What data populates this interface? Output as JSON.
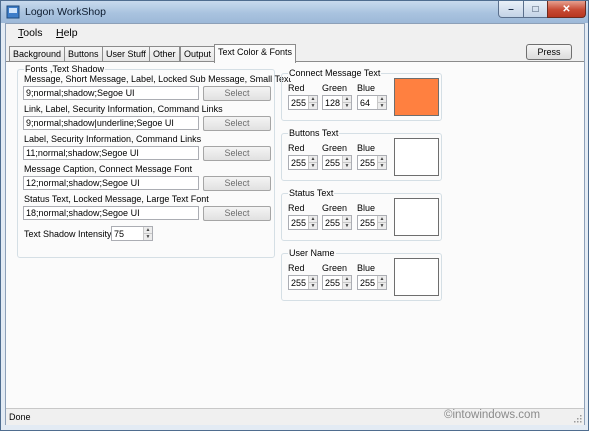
{
  "window": {
    "title": "Logon WorkShop"
  },
  "menu": [
    {
      "label": "Tools",
      "mnemonic": "T",
      "rest": "ools"
    },
    {
      "label": "Help",
      "mnemonic": "H",
      "rest": "elp"
    }
  ],
  "tabs": [
    "Background",
    "Buttons",
    "User Stuff",
    "Other",
    "Output",
    "Text Color & Fonts"
  ],
  "active_tab": "Text Color & Fonts",
  "press_button": "Press",
  "fonts_group": {
    "title": "Fonts ,Text Shadow",
    "rows": [
      {
        "label": "Message, Short Message, Label, Locked Sub Message, Small Text",
        "value": "9;normal;shadow;Segoe UI",
        "button": "Select"
      },
      {
        "label": "Link, Label, Security Information, Command Links",
        "value": "9;normal;shadow|underline;Segoe UI",
        "button": "Select"
      },
      {
        "label": "Label, Security Information, Command Links",
        "value": "11;normal;shadow;Segoe UI",
        "button": "Select"
      },
      {
        "label": "Message Caption, Connect Message Font",
        "value": "12;normal;shadow;Segoe UI",
        "button": "Select"
      },
      {
        "label": "Status Text, Locked Message, Large Text Font",
        "value": "18;normal;shadow;Segoe UI",
        "button": "Select"
      }
    ],
    "shadow_intensity_label": "Text Shadow Intensity:",
    "shadow_intensity_value": "75"
  },
  "color_groups": [
    {
      "title": "Connect Message Text",
      "red_label": "Red",
      "green_label": "Green",
      "blue_label": "Blue",
      "red": "255",
      "green": "128",
      "blue": "64",
      "swatch": "#ff8040"
    },
    {
      "title": "Buttons Text",
      "red_label": "Red",
      "green_label": "Green",
      "blue_label": "Blue",
      "red": "255",
      "green": "255",
      "blue": "255",
      "swatch": "#ffffff"
    },
    {
      "title": "Status Text",
      "red_label": "Red",
      "green_label": "Green",
      "blue_label": "Blue",
      "red": "255",
      "green": "255",
      "blue": "255",
      "swatch": "#ffffff"
    },
    {
      "title": "User Name",
      "red_label": "Red",
      "green_label": "Green",
      "blue_label": "Blue",
      "red": "255",
      "green": "255",
      "blue": "255",
      "swatch": "#ffffff"
    }
  ],
  "status": "Done",
  "watermark": "©intowindows.com",
  "icons": {
    "minimize": "minimize-icon",
    "maximize": "maximize-icon",
    "close": "close-icon",
    "spin_up": "spin-up-icon",
    "spin_down": "spin-down-icon"
  }
}
